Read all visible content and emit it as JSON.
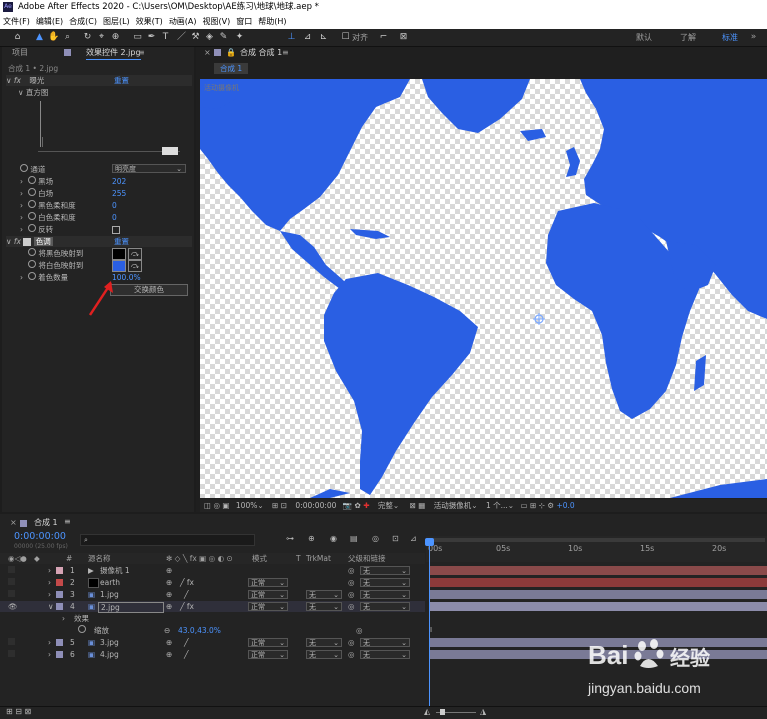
{
  "window": {
    "title": "Adobe After Effects 2020 - C:\\Users\\OM\\Desktop\\AE练习\\地球\\地球.aep *"
  },
  "menu": [
    "文件(F)",
    "编辑(E)",
    "合成(C)",
    "图层(L)",
    "效果(T)",
    "动画(A)",
    "视图(V)",
    "窗口",
    "帮助(H)"
  ],
  "toolbar": {
    "snap_label": "对齐",
    "workspaces": [
      "默认",
      "了解",
      "标准"
    ]
  },
  "effects_panel": {
    "tab_project": "项目",
    "tab_effects": "效果控件 2.jpg",
    "breadcrumb": "合成 1 • 2.jpg",
    "levels": {
      "name": "曝光",
      "reset": "重置",
      "histogram_label": "直方图"
    },
    "props": [
      {
        "label": "通道",
        "value": "明亮度",
        "type": "dropdown"
      },
      {
        "label": "黑场",
        "value": "202",
        "type": "num"
      },
      {
        "label": "白场",
        "value": "255",
        "type": "num"
      },
      {
        "label": "黑色柔和度",
        "value": "0",
        "type": "num"
      },
      {
        "label": "白色柔和度",
        "value": "0",
        "type": "num"
      },
      {
        "label": "反转",
        "value": "",
        "type": "check"
      }
    ],
    "tint": {
      "name": "色调",
      "reset": "重置",
      "props": [
        {
          "label": "将黑色映射到",
          "color": "#000000"
        },
        {
          "label": "将白色映射到",
          "color": "#2a5fe3"
        },
        {
          "label": "着色数量",
          "value": "100.0%"
        }
      ],
      "swap_button": "交换颜色"
    }
  },
  "viewer": {
    "tab": "合成 合成 1",
    "subtab": "合成 1",
    "active_camera_badge": "活动摄像机",
    "colors": {
      "land": "#2a5fe3"
    },
    "controls": {
      "zoom": "100%",
      "timecode": "0:00:00:00",
      "quality": "完整",
      "camera": "活动摄像机",
      "views": "1 个...",
      "exposure": "+0.0"
    }
  },
  "timeline": {
    "tab": "合成 1",
    "timecode": "0:00:00:00",
    "fps": "00000 (25.00 fps)",
    "headers": {
      "name": "源名称",
      "mode": "模式",
      "trkmat": "TrkMat",
      "parent": "父级和链接"
    },
    "ruler": [
      "00s",
      "05s",
      "10s",
      "15s",
      "20s"
    ],
    "layers": [
      {
        "num": "1",
        "name": "摄像机 1",
        "color": "#d5a3b4",
        "mode": "",
        "trk": "",
        "parent": "无",
        "bar": "#8a4a4a",
        "type": "camera"
      },
      {
        "num": "2",
        "name": "earth",
        "color": "#c44a4a",
        "mode": "正常",
        "trk": "",
        "parent": "无",
        "bar": "#8c3a3a",
        "type": "solid"
      },
      {
        "num": "3",
        "name": "1.jpg",
        "color": "#8f8fb8",
        "mode": "正常",
        "trk": "无",
        "parent": "无",
        "bar": "#7a7a96",
        "type": "image"
      },
      {
        "num": "4",
        "name": "2.jpg",
        "color": "#8f8fb8",
        "mode": "正常",
        "trk": "无",
        "parent": "无",
        "bar": "#8c8caa",
        "type": "image"
      },
      {
        "num": "5",
        "name": "3.jpg",
        "color": "#8f8fb8",
        "mode": "正常",
        "trk": "无",
        "parent": "无",
        "bar": "#7a7a96",
        "type": "image"
      },
      {
        "num": "6",
        "name": "4.jpg",
        "color": "#8f8fb8",
        "mode": "正常",
        "trk": "无",
        "parent": "无",
        "bar": "#7a7a96",
        "type": "image"
      }
    ],
    "effects_row": "效果",
    "scale": {
      "label": "缩放",
      "value": "43.0,43.0%"
    }
  },
  "watermark": {
    "brand": "Bai",
    "brand2": "经验",
    "url": "jingyan.baidu.com"
  }
}
